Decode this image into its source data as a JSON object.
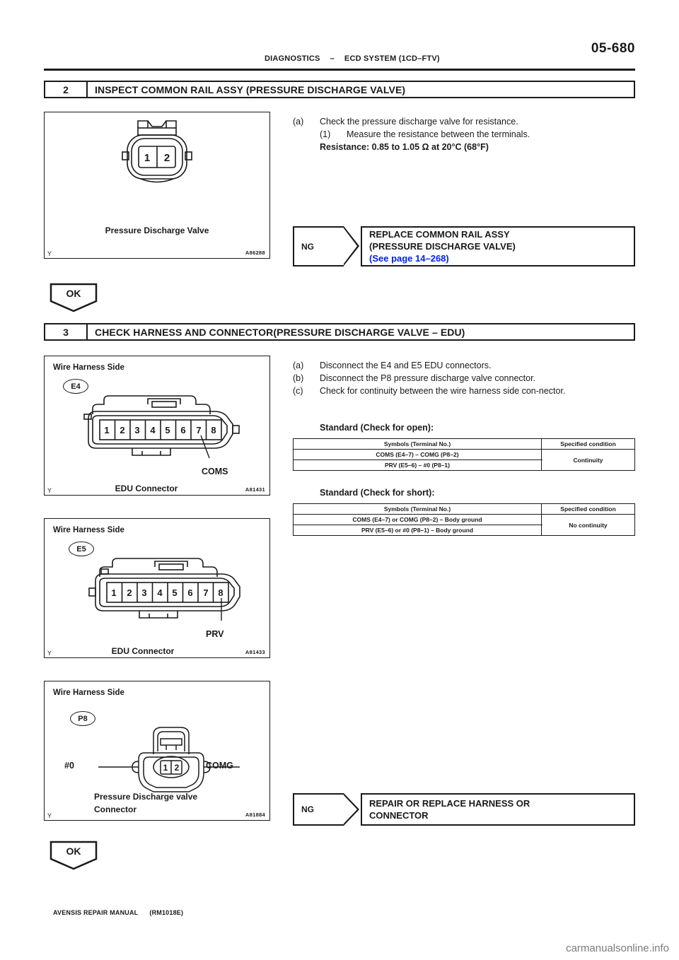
{
  "header": {
    "page_number": "05-680",
    "section": "DIAGNOSTICS",
    "dash": "–",
    "system": "ECD SYSTEM (1CD–FTV)"
  },
  "step2": {
    "number": "2",
    "title": "INSPECT COMMON RAIL ASSY (PRESSURE DISCHARGE VALVE)",
    "instructions": [
      {
        "marker": "(a)",
        "text": "Check the pressure discharge valve for resistance."
      },
      {
        "marker": "(1)",
        "text": "Measure the resistance between the terminals."
      }
    ],
    "spec": "Resistance: 0.85 to 1.05 Ω at 20°C (68°F)",
    "figure": {
      "caption": "Pressure Discharge Valve",
      "code": "A86288",
      "pins": [
        "1",
        "2"
      ]
    },
    "ng": {
      "tag": "NG",
      "line1": "REPLACE COMMON RAIL ASSY",
      "line2": "(PRESSURE DISCHARGE VALVE)",
      "reference": "(See page 14–268)"
    },
    "ok": "OK"
  },
  "step3": {
    "number": "3",
    "title": "CHECK HARNESS AND CONNECTOR(PRESSURE DISCHARGE VALVE – EDU)",
    "instructions": [
      {
        "marker": "(a)",
        "text": "Disconnect the E4 and E5 EDU connectors."
      },
      {
        "marker": "(b)",
        "text": "Disconnect the P8 pressure discharge valve connector."
      },
      {
        "marker": "(c)",
        "text": "Check for continuity between the wire harness side con-nector."
      }
    ],
    "standard_open_label": "Standard (Check for open):",
    "standard_short_label": "Standard (Check for short):",
    "table_open": {
      "headers": [
        "Symbols (Terminal No.)",
        "Specified condition"
      ],
      "rows": [
        "COMS (E4–7) – COMG (P8–2)",
        "PRV (E5–6) – #0 (P8–1)"
      ],
      "condition": "Continuity"
    },
    "table_short": {
      "headers": [
        "Symbols (Terminal No.)",
        "Specified condition"
      ],
      "rows": [
        "COMS (E4–7) or COMG (P8–2) – Body ground",
        "PRV (E5–6) or #0 (P8–1) – Body ground"
      ],
      "condition": "No continuity"
    },
    "figures": [
      {
        "side_label": "Wire Harness Side",
        "badge": "E4",
        "caption": "EDU Connector",
        "lead": "COMS",
        "code": "A81431",
        "pins": [
          "1",
          "2",
          "3",
          "4",
          "5",
          "6",
          "7",
          "8"
        ]
      },
      {
        "side_label": "Wire Harness Side",
        "badge": "E5",
        "caption": "EDU Connector",
        "lead": "PRV",
        "code": "A81433",
        "pins": [
          "1",
          "2",
          "3",
          "4",
          "5",
          "6",
          "7",
          "8"
        ]
      },
      {
        "side_label": "Wire Harness Side",
        "badge": "P8",
        "caption_line1": "Pressure Discharge valve",
        "caption_line2": "Connector",
        "lead_left": "#0",
        "lead_right": "COMG",
        "code": "A81884",
        "pins": [
          "1",
          "2"
        ]
      }
    ],
    "ng": {
      "tag": "NG",
      "line1": "REPAIR    OR    REPLACE    HARNESS    OR",
      "line2": "CONNECTOR"
    },
    "ok": "OK"
  },
  "footer": {
    "manual": "AVENSIS REPAIR MANUAL",
    "code": "(RM1018E)"
  },
  "watermark": "carmanualsonline.info"
}
